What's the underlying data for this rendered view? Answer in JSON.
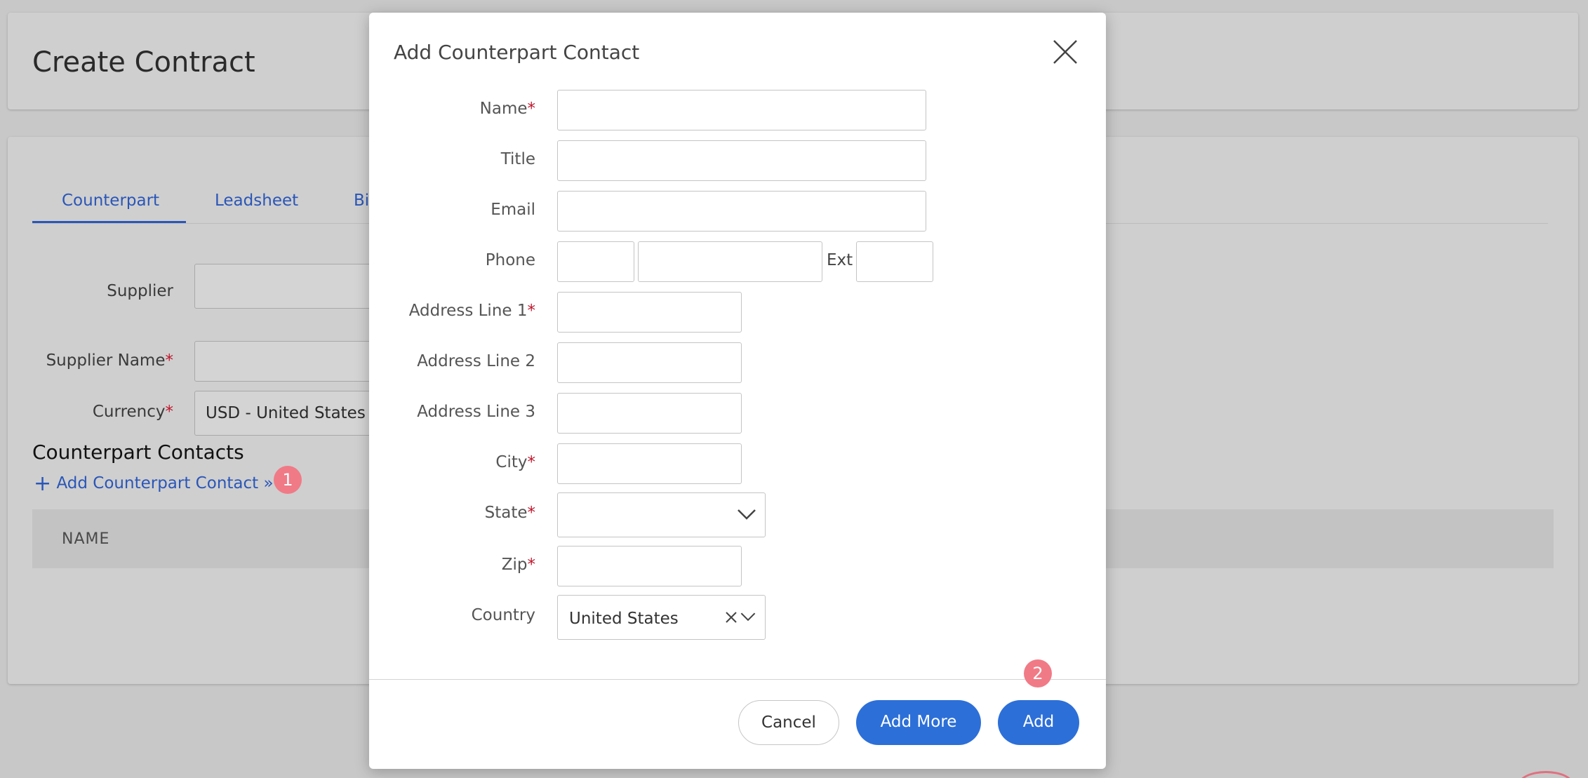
{
  "page": {
    "title": "Create Contract",
    "tabs": [
      "Counterpart",
      "Leadsheet",
      "Bi"
    ],
    "labels": {
      "supplier": "Supplier",
      "supplier_name": "Supplier Name",
      "currency": "Currency"
    },
    "currency_value": "USD - United States",
    "section_title": "Counterpart Contacts",
    "add_contact_link": "Add Counterpart Contact »",
    "table_header_name": "NAME",
    "badge_1": "1",
    "required_mark": "*"
  },
  "modal": {
    "title": "Add Counterpart Contact",
    "fields": {
      "name": "Name",
      "title": "Title",
      "email": "Email",
      "phone": "Phone",
      "ext": "Ext",
      "address1": "Address Line 1",
      "address2": "Address Line 2",
      "address3": "Address Line 3",
      "city": "City",
      "state": "State",
      "zip": "Zip",
      "country": "Country"
    },
    "country_value": "United States",
    "buttons": {
      "cancel": "Cancel",
      "add_more": "Add More",
      "add": "Add"
    },
    "badge_2": "2"
  },
  "colors": {
    "accent": "#2c6fd8",
    "link": "#2a56b8",
    "required": "#c0162c",
    "badge": "#f07a86"
  }
}
